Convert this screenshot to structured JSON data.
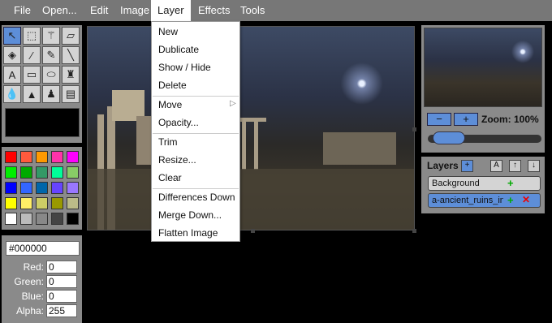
{
  "menubar": {
    "items": [
      {
        "label": "File"
      },
      {
        "label": "Open..."
      },
      {
        "label": "Edit"
      },
      {
        "label": "Image"
      },
      {
        "label": "Layer"
      },
      {
        "label": "Effects"
      },
      {
        "label": "Tools"
      }
    ]
  },
  "layer_menu": {
    "items": [
      "New",
      "Dublicate",
      "Show / Hide",
      "Delete",
      "Move",
      "Opacity...",
      "Trim",
      "Resize...",
      "Clear",
      "Differences Down",
      "Merge Down...",
      "Flatten Image"
    ]
  },
  "tools": [
    {
      "icon": "cursor-icon",
      "glyph": "↖"
    },
    {
      "icon": "select-rect-icon",
      "glyph": "⬚"
    },
    {
      "icon": "magic-wand-icon",
      "glyph": "⚚"
    },
    {
      "icon": "eraser-icon",
      "glyph": "▱"
    },
    {
      "icon": "fill-bucket-icon",
      "glyph": "◈"
    },
    {
      "icon": "eyedropper-icon",
      "glyph": "⁄"
    },
    {
      "icon": "pencil-icon",
      "glyph": "✎"
    },
    {
      "icon": "line-icon",
      "glyph": "╲"
    },
    {
      "icon": "text-icon",
      "glyph": "A"
    },
    {
      "icon": "rectangle-icon",
      "glyph": "▭"
    },
    {
      "icon": "ellipse-icon",
      "glyph": "⬭"
    },
    {
      "icon": "brush-icon",
      "glyph": "♜"
    },
    {
      "icon": "blur-drop-icon",
      "glyph": "💧"
    },
    {
      "icon": "sharpen-icon",
      "glyph": "▲"
    },
    {
      "icon": "stamp-icon",
      "glyph": "♟"
    },
    {
      "icon": "gradient-icon",
      "glyph": "▤"
    }
  ],
  "palette": [
    "#ff0000",
    "#ff5a3c",
    "#ff9900",
    "#ff33aa",
    "#ff00ff",
    "#00ee00",
    "#00aa00",
    "#339966",
    "#00ff99",
    "#88cc66",
    "#0000ff",
    "#3366ff",
    "#0066aa",
    "#6644ff",
    "#9977ff",
    "#ffff00",
    "#ffee66",
    "#cccc66",
    "#999900",
    "#bbbb88",
    "#ffffff",
    "#bbbbbb",
    "#888888",
    "#444444",
    "#000000"
  ],
  "color": {
    "hex": "#000000",
    "red_label": "Red:",
    "red": "0",
    "green_label": "Green:",
    "green": "0",
    "blue_label": "Blue:",
    "blue": "0",
    "alpha_label": "Alpha:",
    "alpha": "255"
  },
  "preview": {
    "zoom_out": "−",
    "zoom_in": "+",
    "zoom_label": "Zoom: 100%",
    "zoom_percent": 100
  },
  "layers": {
    "title": "Layers",
    "add": "+",
    "btn_a": "A",
    "btn_up": "↑",
    "btn_down": "↓",
    "items": [
      {
        "name": "Background",
        "add": "+"
      },
      {
        "name": "a-ancient_ruins_in",
        "add": "+",
        "remove": "✕"
      }
    ]
  }
}
